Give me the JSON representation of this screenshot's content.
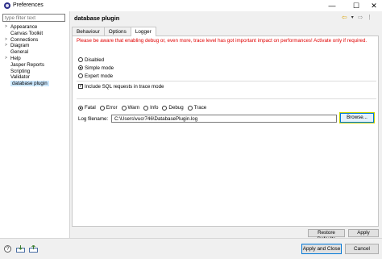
{
  "window": {
    "title": "Preferences",
    "minimize_glyph": "—",
    "maximize_glyph": "☐",
    "close_glyph": "✕"
  },
  "sidebar": {
    "filter_placeholder": "type filter text",
    "items": [
      {
        "label": "Appearance",
        "expandable": true
      },
      {
        "label": "Canvas Toolkit",
        "expandable": false
      },
      {
        "label": "Connections",
        "expandable": true
      },
      {
        "label": "Diagram",
        "expandable": true
      },
      {
        "label": "General",
        "expandable": false
      },
      {
        "label": "Help",
        "expandable": true
      },
      {
        "label": "Jasper Reports",
        "expandable": false
      },
      {
        "label": "Scripting",
        "expandable": false
      },
      {
        "label": "Validator",
        "expandable": false
      },
      {
        "label": "database plugin",
        "expandable": false,
        "selected": true
      }
    ]
  },
  "header": {
    "title": "database plugin",
    "back_glyph": "⇦",
    "forward_glyph": "⇨",
    "menu_glyph": "▾"
  },
  "tabs": [
    {
      "label": "Behaviour"
    },
    {
      "label": "Options"
    },
    {
      "label": "Logger",
      "active": true
    }
  ],
  "logger": {
    "warning": "Please be aware that enabling debug or, even more, trace level has got important impact on performances! Activate only if required.",
    "modes": [
      "Disabled",
      "Simple mode",
      "Expert mode"
    ],
    "selected_mode": "Simple mode",
    "include_sql_label": "Include SQL requests in trace mode",
    "include_sql_checked": true,
    "levels": [
      "Fatal",
      "Error",
      "Warn",
      "Info",
      "Debug",
      "Trace"
    ],
    "selected_level": "Fatal",
    "log_filename_label": "Log filename:",
    "log_filename_value": "C:\\Users\\vucr746\\DatabasePlugin.log",
    "browse_label": "Browse..."
  },
  "buttons": {
    "restore_defaults": "Restore Defaults",
    "apply": "Apply",
    "apply_and_close": "Apply and Close",
    "cancel": "Cancel"
  },
  "bottom_icons": {
    "help_glyph": "?"
  },
  "colors": {
    "warning": "#e00000",
    "selection": "#cce8ff",
    "focus_border": "#0078d7",
    "nav_back": "#d9a300"
  }
}
